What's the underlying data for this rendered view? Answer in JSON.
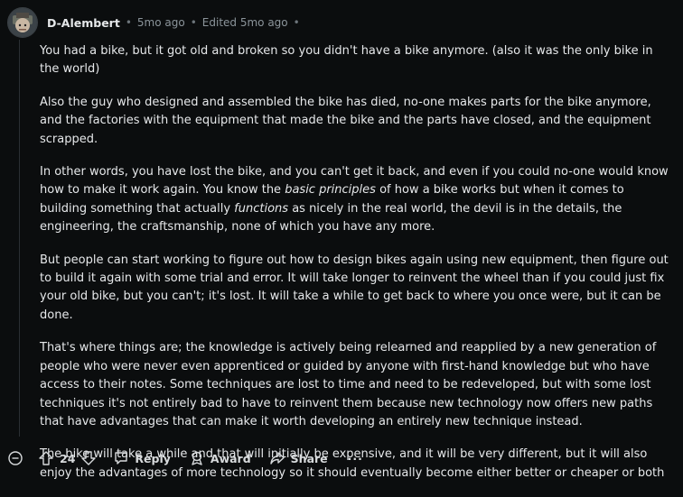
{
  "comment": {
    "author": "D-Alembert",
    "time": "5mo ago",
    "edited": "Edited 5mo ago",
    "separator": "•",
    "paragraphs": [
      [
        {
          "t": "You had a bike, but it got old and broken so you didn't have a bike anymore. (also it was the only bike in the world)"
        }
      ],
      [
        {
          "t": "Also the guy who designed and assembled the bike has died, no-one makes parts for the bike anymore, and the factories with the equipment that made the bike and the parts have closed, and the equipment scrapped."
        }
      ],
      [
        {
          "t": "In other words, you have lost the bike, and you can't get it back, and even if you could no-one would know how to make it work again. You know the "
        },
        {
          "t": "basic principles",
          "i": true
        },
        {
          "t": " of how a bike works but when it comes to building something that actually "
        },
        {
          "t": "functions",
          "i": true
        },
        {
          "t": " as nicely in the real world, the devil is in the details, the engineering, the craftsmanship, none of which you have any more."
        }
      ],
      [
        {
          "t": "But people can start working to figure out how to design bikes again using new equipment, then figure out to build it again with some trial and error. It will take longer to reinvent the wheel than if you could just fix your old bike, but you can't; it's lost. It will take a while to get back to where you once were, but it can be done."
        }
      ],
      [
        {
          "t": "That's where things are; the knowledge is actively being relearned and reapplied by a new generation of people who were never even apprenticed or guided by anyone with first-hand knowledge but who have access to their notes. Some techniques are lost to time and need to be redeveloped, but with some lost techniques it's not entirely bad to have to reinvent them because new technology now offers new paths that have advantages that can make it worth developing an entirely new technique instead."
        }
      ],
      [
        {
          "t": "The bike will take a while and that will initially be expensive, and it will be very different, but it will also enjoy the advantages of more technology so it should eventually become either better or cheaper or both"
        }
      ]
    ]
  },
  "actions": {
    "score": "24",
    "reply": "Reply",
    "award": "Award",
    "share": "Share",
    "more": "···"
  },
  "icons": {
    "collapse": "collapse-icon",
    "upvote": "upvote-icon",
    "downvote": "downvote-icon",
    "reply": "reply-icon",
    "award": "award-icon",
    "share": "share-icon"
  }
}
